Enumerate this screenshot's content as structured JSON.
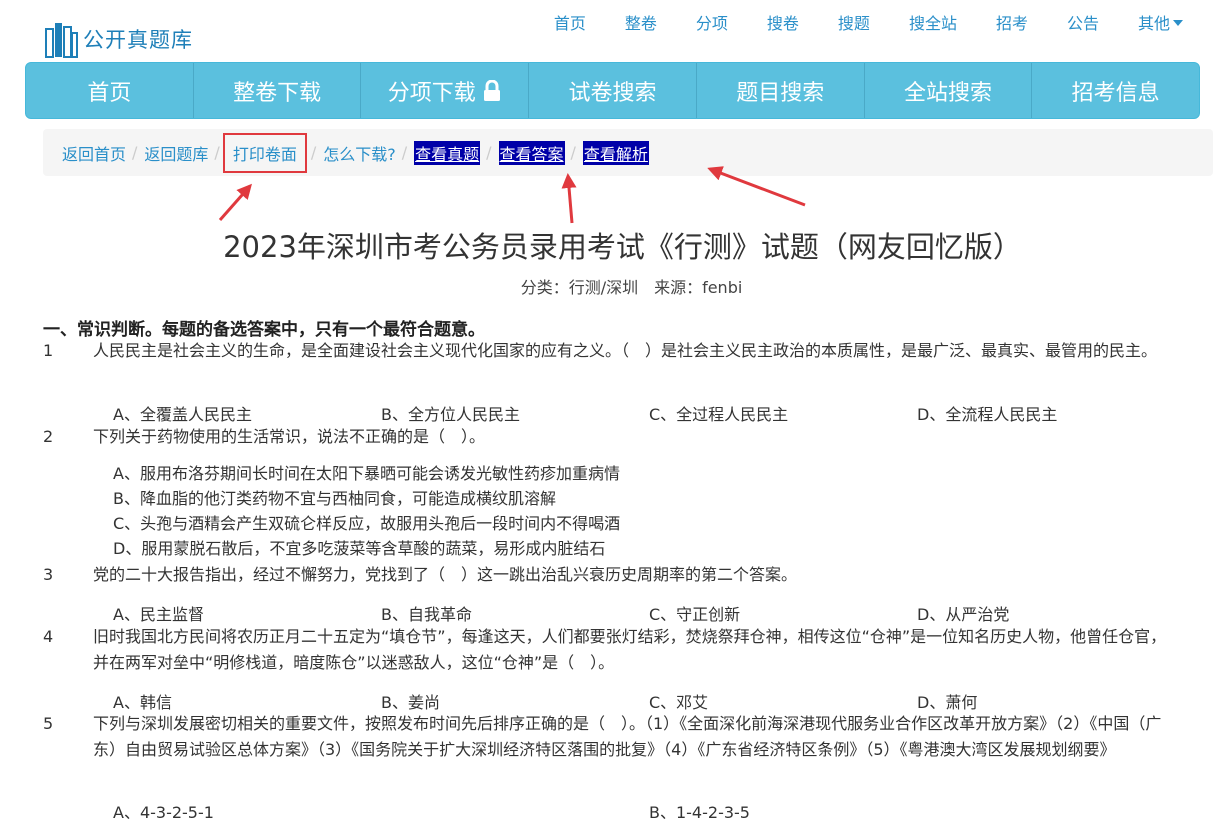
{
  "site": {
    "logo_text": "公开真题库"
  },
  "top_nav": [
    "首页",
    "整卷",
    "分项",
    "搜卷",
    "搜题",
    "搜全站",
    "招考",
    "公告",
    "其他"
  ],
  "main_nav": [
    "首页",
    "整卷下载",
    "分项下载",
    "试卷搜索",
    "题目搜索",
    "全站搜索",
    "招考信息"
  ],
  "breadcrumb": [
    "返回首页",
    "返回题库",
    "打印卷面",
    "怎么下载?",
    "查看真题",
    "查看答案",
    "查看解析"
  ],
  "paper": {
    "title": "2023年深圳市考公务员录用考试《行测》试题（网友回忆版）",
    "meta": "分类：行测/深圳　来源：fenbi",
    "section": "一、常识判断。每题的备选答案中，只有一个最符合题意。"
  },
  "questions": [
    {
      "num": "1",
      "stem": "人民民主是社会主义的生命，是全面建设社会主义现代化国家的应有之义。（　）是社会主义民主政治的本质属性，是最广泛、最真实、最管用的民主。",
      "options": [
        "A、全覆盖人民民主",
        "B、全方位人民民主",
        "C、全过程人民民主",
        "D、全流程人民民主"
      ]
    },
    {
      "num": "2",
      "stem": "下列关于药物使用的生活常识，说法不正确的是（　）。",
      "options": [
        "A、服用布洛芬期间长时间在太阳下暴晒可能会诱发光敏性药疹加重病情",
        "B、降血脂的他汀类药物不宜与西柚同食，可能造成横纹肌溶解",
        "C、头孢与酒精会产生双硫仑样反应，故服用头孢后一段时间内不得喝酒",
        "D、服用蒙脱石散后，不宜多吃菠菜等含草酸的蔬菜，易形成内脏结石"
      ]
    },
    {
      "num": "3",
      "stem": "党的二十大报告指出，经过不懈努力，党找到了（　）这一跳出治乱兴衰历史周期率的第二个答案。",
      "options": [
        "A、民主监督",
        "B、自我革命",
        "C、守正创新",
        "D、从严治党"
      ]
    },
    {
      "num": "4",
      "stem": "旧时我国北方民间将农历正月二十五定为“填仓节”，每逢这天，人们都要张灯结彩，焚烧祭拜仓神，相传这位“仓神”是一位知名历史人物，他曾任仓官，并在两军对垒中“明修栈道，暗度陈仓”以迷惑敌人，这位“仓神”是（　）。",
      "options": [
        "A、韩信",
        "B、姜尚",
        "C、邓艾",
        "D、萧何"
      ]
    },
    {
      "num": "5",
      "stem": "下列与深圳发展密切相关的重要文件，按照发布时间先后排序正确的是（　）。（1）《全面深化前海深港现代服务业合作区改革开放方案》（2）《中国（广东）自由贸易试验区总体方案》（3）《国务院关于扩大深圳经济特区落围的批复》（4）《广东省经济特区条例》（5）《粤港澳大湾区发展规划纲要》",
      "options": [
        "A、4-3-2-5-1",
        "B、1-4-2-3-5"
      ]
    }
  ],
  "colors": {
    "nav_bg": "#5bc0de",
    "link": "#2a8fc9",
    "highlight_bg": "#0000a8",
    "annotation_red": "#e0393e"
  }
}
